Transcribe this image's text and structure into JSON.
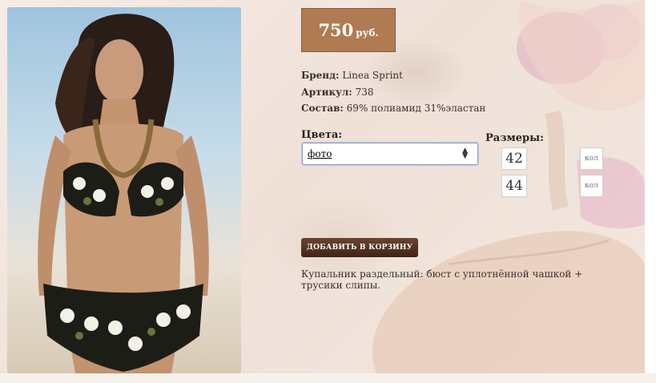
{
  "product": {
    "price_value": "750",
    "price_unit": "руб.",
    "brand_label": "Бренд:",
    "brand_value": "Linea Sprint",
    "article_label": "Артикул:",
    "article_value": "738",
    "composition_label": "Состав:",
    "composition_value": "69% полиамид 31%эластан",
    "colors_label": "Цвета:",
    "color_selected": "фото",
    "sizes_label": "Размеры:",
    "sizes": [
      "42",
      "44"
    ],
    "qty_placeholder": "кол",
    "add_to_cart_label": "ДОБАВИТЬ В КОРЗИНУ",
    "description": "Купальник раздельный: бюст с уплотнённой чашкой + трусики слипы."
  },
  "colors": {
    "price_bg": "#b07b52",
    "button_bg": "#4f2f1f",
    "page_bg": "#f1e6de"
  }
}
